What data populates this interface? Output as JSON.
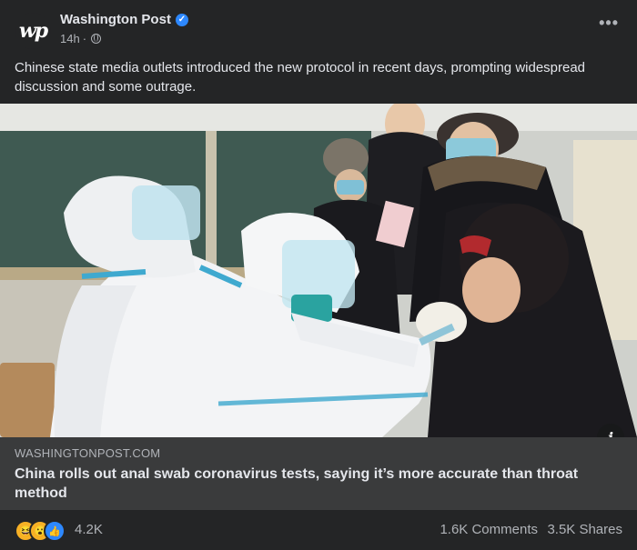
{
  "post": {
    "page_name": "Washington Post",
    "avatar_text": "wp",
    "time": "14h",
    "separator": "·",
    "more_label": "•••",
    "caption": "Chinese state media outlets introduced the new protocol in recent days, prompting widespread discussion and some outrage."
  },
  "link": {
    "domain": "WASHINGTONPOST.COM",
    "headline": "China rolls out anal swab coronavirus tests, saying it’s more accurate than throat method",
    "info_label": "i"
  },
  "stats": {
    "reactions": [
      "haha-icon",
      "wow-icon",
      "like-icon"
    ],
    "reaction_count": "4.2K",
    "comments": "1.6K Comments",
    "shares": "3.5K Shares"
  },
  "colors": {
    "card_bg": "#242526",
    "link_bg": "#3a3b3c",
    "text_primary": "#e4e6eb",
    "text_secondary": "#b0b3b8",
    "verified_blue": "#2d88ff"
  }
}
